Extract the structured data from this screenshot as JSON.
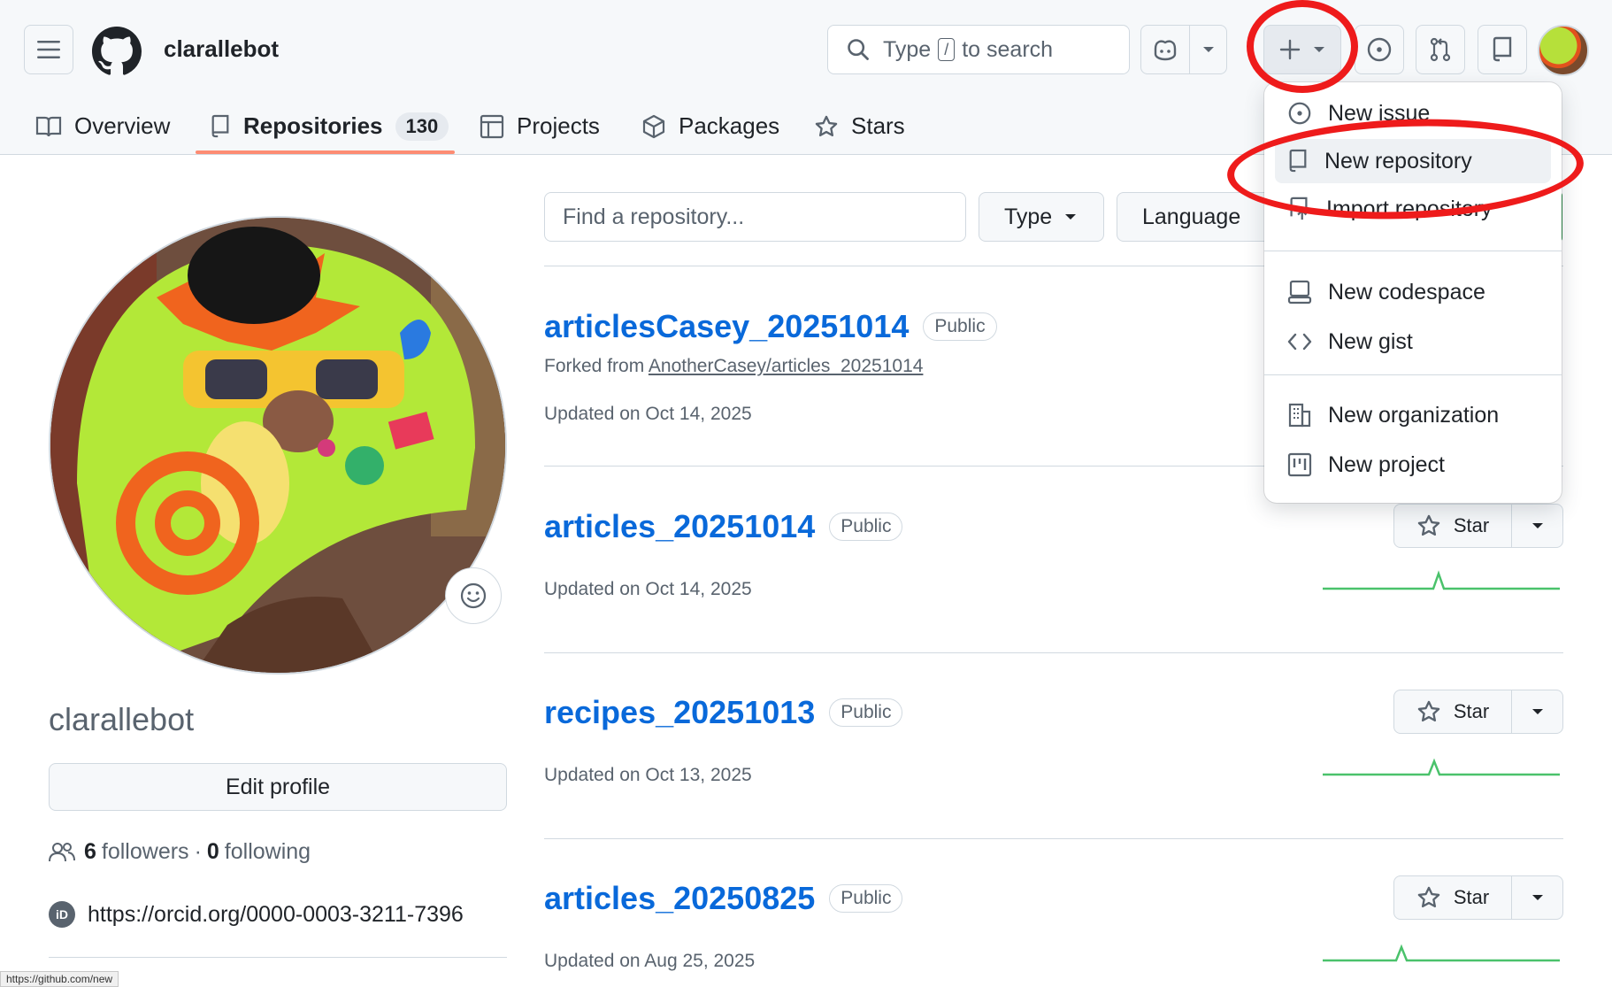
{
  "header": {
    "username": "clarallebot",
    "search": {
      "prefix": "Type",
      "key": "/",
      "suffix": "to search"
    }
  },
  "tabs": [
    {
      "label": "Overview"
    },
    {
      "label": "Repositories",
      "count": "130"
    },
    {
      "label": "Projects"
    },
    {
      "label": "Packages"
    },
    {
      "label": "Stars"
    }
  ],
  "profile": {
    "name": "clarallebot",
    "edit_label": "Edit profile",
    "followers_count": "6",
    "followers_label": "followers",
    "separator": "·",
    "following_count": "0",
    "following_label": "following",
    "orcid_url": "https://orcid.org/0000-0003-3211-7396",
    "orcid_badge": "iD"
  },
  "filters": {
    "find_placeholder": "Find a repository...",
    "type_label": "Type",
    "language_label": "Language"
  },
  "repos": [
    {
      "name": "articlesCasey_20251014",
      "visibility": "Public",
      "forked_prefix": "Forked from",
      "forked_from": "AnotherCasey/articles_20251014",
      "updated": "Updated on Oct 14, 2025"
    },
    {
      "name": "articles_20251014",
      "visibility": "Public",
      "updated": "Updated on Oct 14, 2025",
      "star_label": "Star"
    },
    {
      "name": "recipes_20251013",
      "visibility": "Public",
      "updated": "Updated on Oct 13, 2025",
      "star_label": "Star"
    },
    {
      "name": "articles_20250825",
      "visibility": "Public",
      "updated": "Updated on Aug 25, 2025",
      "star_label": "Star"
    }
  ],
  "create_menu": {
    "items": [
      {
        "label": "New issue",
        "icon": "issue-opened-icon"
      },
      {
        "label": "New repository",
        "icon": "repo-icon"
      },
      {
        "label": "Import repository",
        "icon": "repo-push-icon"
      },
      {
        "label": "New codespace",
        "icon": "codespaces-icon"
      },
      {
        "label": "New gist",
        "icon": "code-icon"
      },
      {
        "label": "New organization",
        "icon": "organization-icon"
      },
      {
        "label": "New project",
        "icon": "project-icon"
      }
    ]
  },
  "status_bar": {
    "url": "https://github.com/new"
  },
  "colors": {
    "link": "#0969da",
    "tab_underline": "#fd8c73",
    "annotation_red": "#ee1b1b",
    "sparkline": "#4ac26b"
  }
}
